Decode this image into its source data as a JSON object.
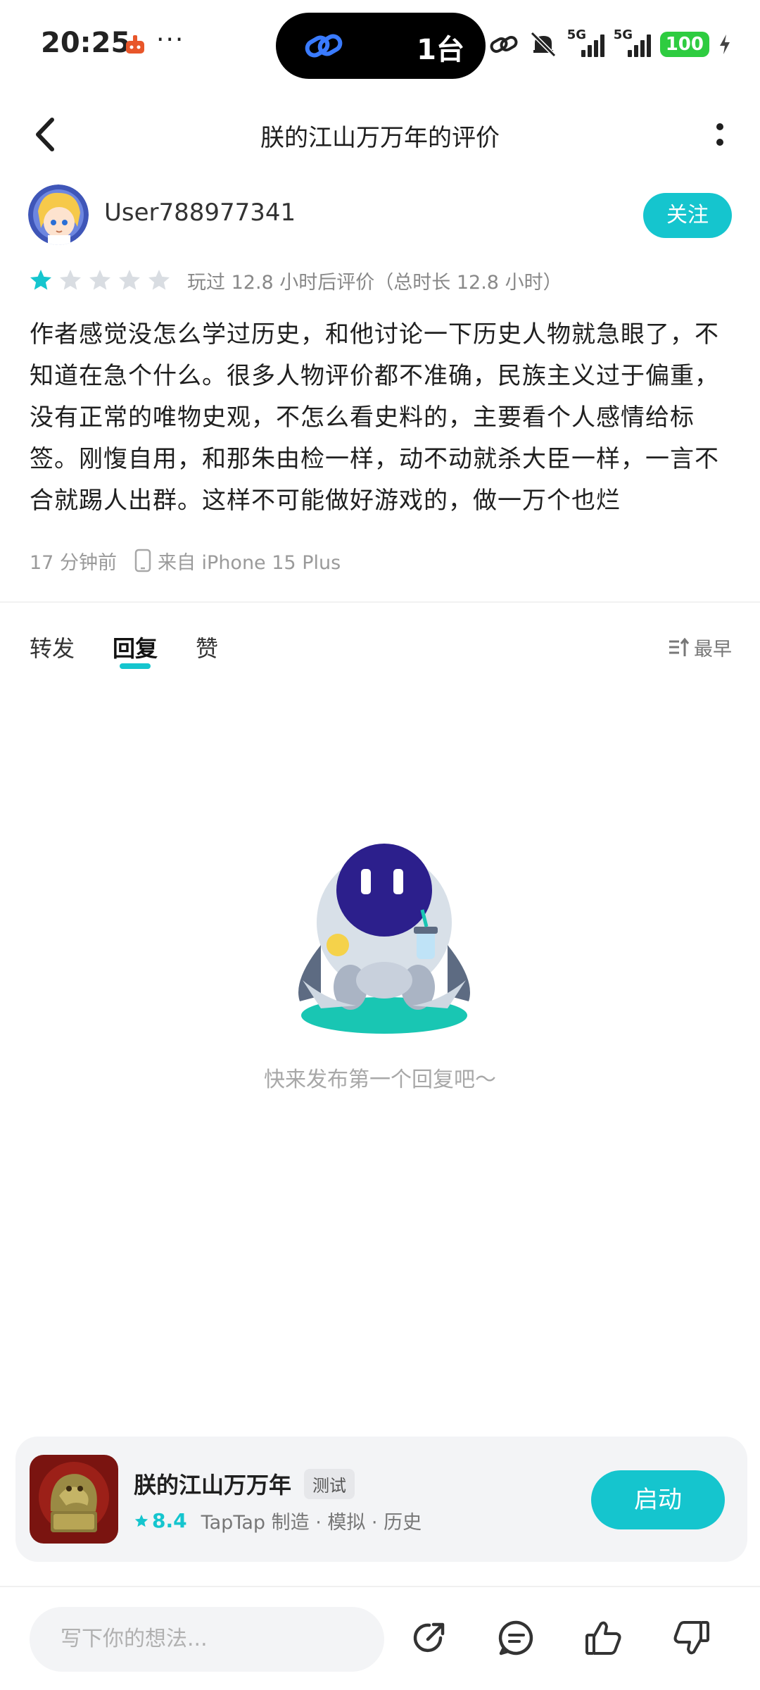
{
  "status_bar": {
    "time": "20:25",
    "more": "···",
    "island_text": "1台",
    "network_1": "5G",
    "network_2": "5G",
    "battery": "100"
  },
  "header": {
    "title": "朕的江山万万年的评价"
  },
  "review": {
    "username": "User788977341",
    "follow_label": "关注",
    "rating": 1,
    "rating_max": 5,
    "play_info": "玩过 12.8 小时后评价（总时长 12.8 小时）",
    "body_lines": [
      "作者感觉没怎么学过历史，和他讨论一下历史人物就急眼了，不",
      "知道在急个什么。很多人物评价都不准确，民族主义过于偏重，",
      "没有正常的唯物史观，不怎么看史料的，主要看个人感情给标",
      "签。刚愎自用，和那朱由检一样，动不动就杀大臣一样，一言不",
      "合就踢人出群。这样不可能做好游戏的，做一万个也烂"
    ],
    "time_ago": "17 分钟前",
    "device": "来自 iPhone 15 Plus"
  },
  "tabs": [
    {
      "label": "转发",
      "active": false
    },
    {
      "label": "回复",
      "active": true
    },
    {
      "label": "赞",
      "active": false
    }
  ],
  "sort_label": "最早",
  "empty_text": "快来发布第一个回复吧～",
  "game": {
    "name": "朕的江山万万年",
    "badge": "测试",
    "score": "8.4",
    "meta": "TapTap 制造 · 模拟 · 历史",
    "launch_label": "启动"
  },
  "bottom_bar": {
    "placeholder": "写下你的想法..."
  },
  "colors": {
    "accent": "#15c5ce",
    "star_active": "#15c5ce",
    "star_inactive": "#d9dde2"
  }
}
